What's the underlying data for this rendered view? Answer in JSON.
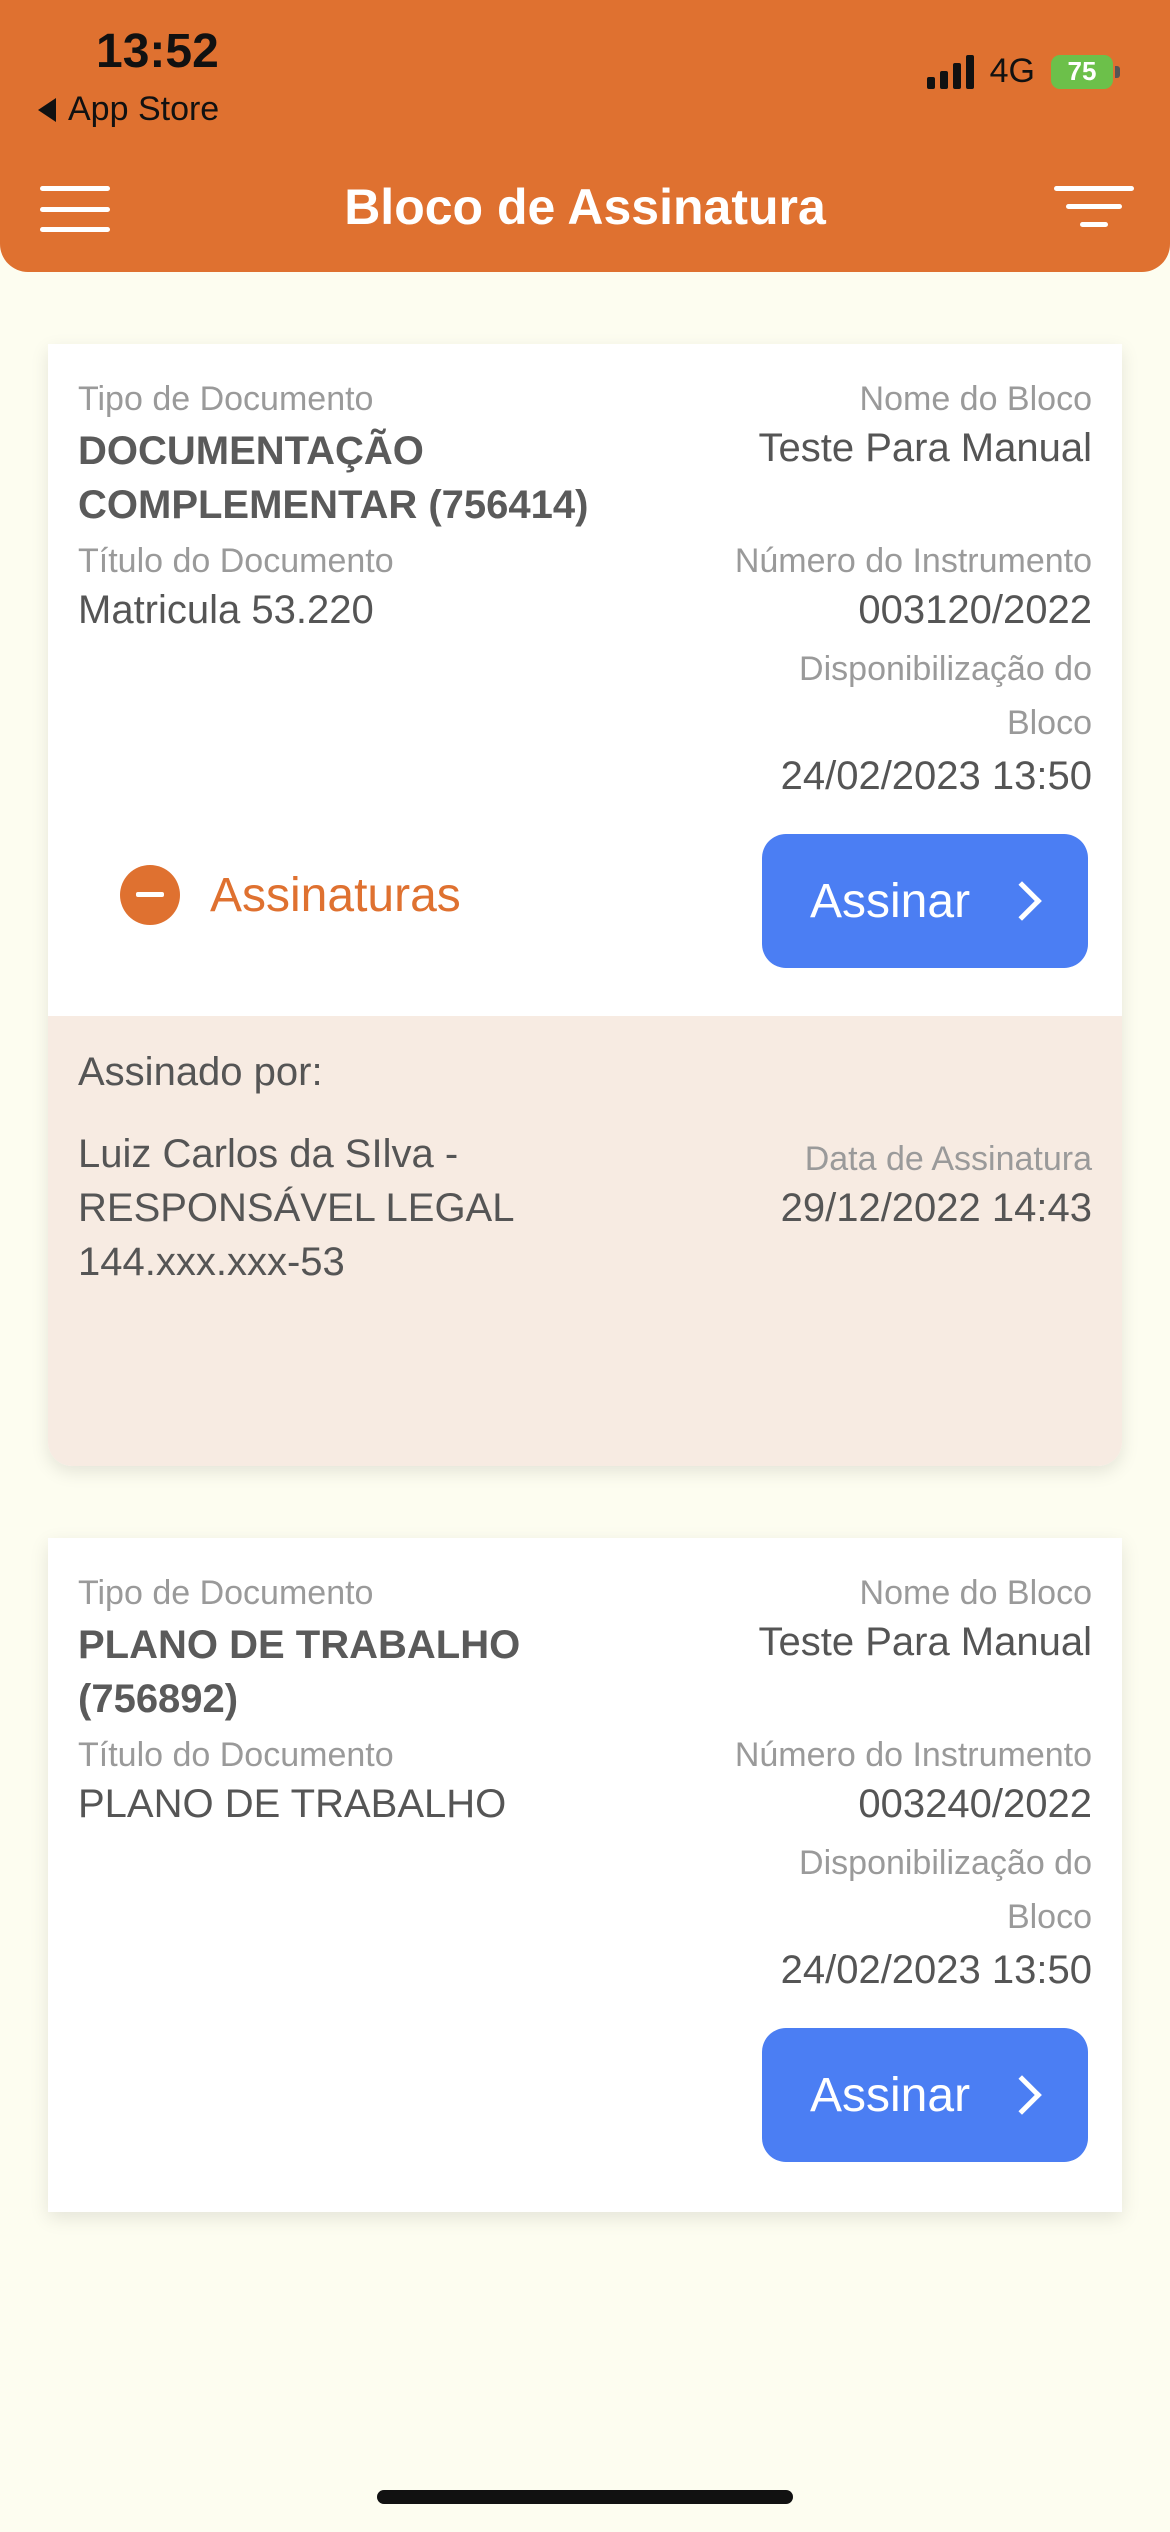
{
  "status_bar": {
    "time": "13:52",
    "back_label": "App Store",
    "network": "4G",
    "battery": "75"
  },
  "header": {
    "title": "Bloco de Assinatura",
    "menu_icon": "hamburger-menu-icon",
    "filter_icon": "filter-icon"
  },
  "colors": {
    "header": "#df7130",
    "button": "#4b7ef3",
    "background": "#fdfdf0",
    "signed_panel": "#f7ebe2"
  },
  "cards": [
    {
      "tipo_label": "Tipo de Documento",
      "tipo_line1": "DOCUMENTAÇÃO",
      "tipo_line2": "COMPLEMENTAR (756414)",
      "nome_label": "Nome do Bloco",
      "nome_value": "Teste Para Manual",
      "titulo_label": "Título do Documento",
      "titulo_value": "Matricula 53.220",
      "numero_label": "Número do Instrumento",
      "numero_value": "003120/2022",
      "disp_label_1": "Disponibilização do",
      "disp_label_2": "Bloco",
      "disp_value": "24/02/2023 13:50",
      "assinaturas_label": "Assinaturas",
      "button_label": "Assinar",
      "signed": {
        "heading": "Assinado por:",
        "signer_line1": "Luiz Carlos da SIlva -",
        "signer_line2": "RESPONSÁVEL LEGAL",
        "signer_line3": "144.xxx.xxx-53",
        "date_label": "Data de Assinatura",
        "date_value": "29/12/2022 14:43"
      }
    },
    {
      "tipo_label": "Tipo de Documento",
      "tipo_line1": "PLANO DE TRABALHO",
      "tipo_line2": "(756892)",
      "nome_label": "Nome do Bloco",
      "nome_value": "Teste Para Manual",
      "titulo_label": "Título do Documento",
      "titulo_value": "PLANO DE TRABALHO",
      "numero_label": "Número do Instrumento",
      "numero_value": "003240/2022",
      "disp_label_1": "Disponibilização do",
      "disp_label_2": "Bloco",
      "disp_value": "24/02/2023 13:50",
      "button_label": "Assinar"
    }
  ]
}
